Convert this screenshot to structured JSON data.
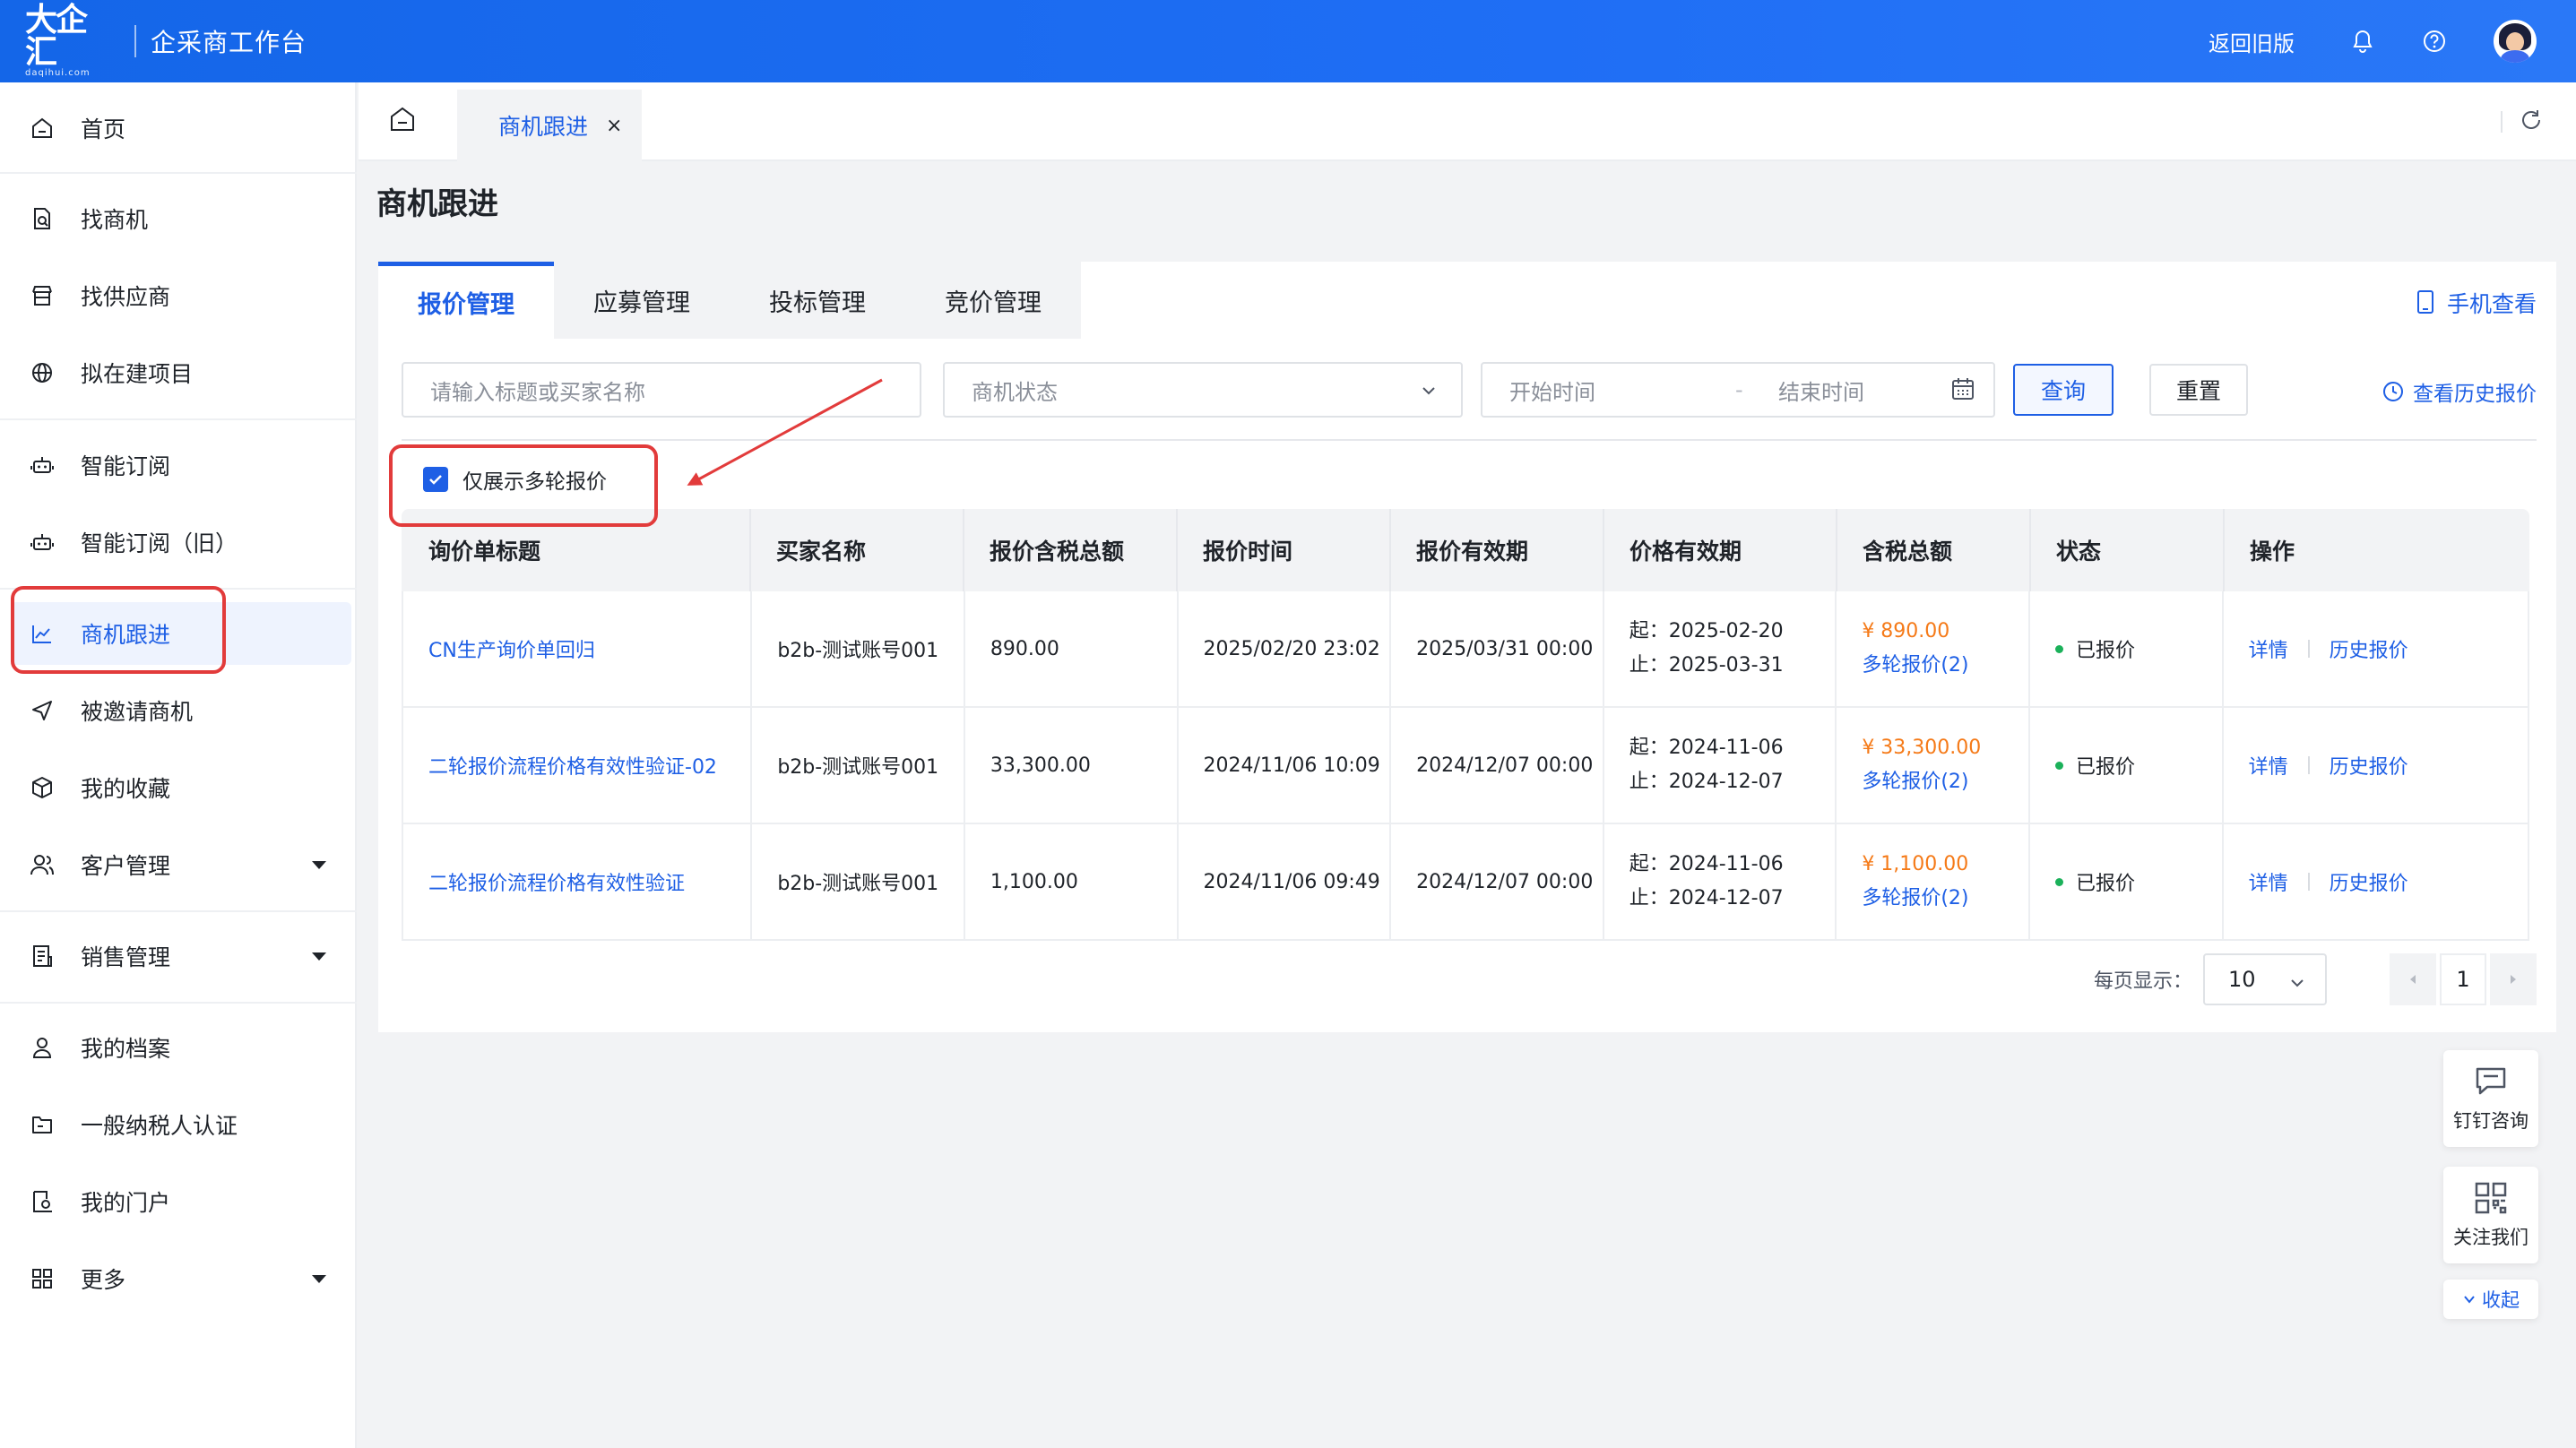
{
  "header": {
    "logo_main": "大企汇",
    "logo_sub": "daqihui.com",
    "app_title": "企采商工作台",
    "old_version": "返回旧版"
  },
  "sidebar": {
    "items": [
      {
        "label": "首页",
        "icon": "home-icon"
      },
      {
        "label": "找商机",
        "icon": "file-search-icon"
      },
      {
        "label": "找供应商",
        "icon": "store-icon"
      },
      {
        "label": "拟在建项目",
        "icon": "globe-icon"
      },
      {
        "label": "智能订阅",
        "icon": "robot-icon"
      },
      {
        "label": "智能订阅（旧）",
        "icon": "robot-icon"
      },
      {
        "label": "商机跟进",
        "icon": "chart-icon"
      },
      {
        "label": "被邀请商机",
        "icon": "send-icon"
      },
      {
        "label": "我的收藏",
        "icon": "cube-icon"
      },
      {
        "label": "客户管理",
        "icon": "users-icon"
      },
      {
        "label": "销售管理",
        "icon": "document-icon"
      },
      {
        "label": "我的档案",
        "icon": "user-icon"
      },
      {
        "label": "一般纳税人认证",
        "icon": "folder-icon"
      },
      {
        "label": "我的门户",
        "icon": "portal-icon"
      },
      {
        "label": "更多",
        "icon": "grid-icon"
      }
    ]
  },
  "tabs": {
    "active_label": "商机跟进",
    "close": "×"
  },
  "page": {
    "title": "商机跟进",
    "subtabs": [
      "报价管理",
      "应募管理",
      "投标管理",
      "竞价管理"
    ],
    "mobile_view": "手机查看",
    "history_quote": "查看历史报价"
  },
  "filters": {
    "keyword_placeholder": "请输入标题或买家名称",
    "status_placeholder": "商机状态",
    "start_placeholder": "开始时间",
    "range_sep": "-",
    "end_placeholder": "结束时间",
    "query_label": "查询",
    "reset_label": "重置",
    "multi_round_label": "仅展示多轮报价"
  },
  "table": {
    "headers": [
      "询价单标题",
      "买家名称",
      "报价含税总额",
      "报价时间",
      "报价有效期",
      "价格有效期",
      "含税总额",
      "状态",
      "操作"
    ],
    "rows": [
      {
        "title": "CN生产询价单回归",
        "buyer": "b2b-测试账号001",
        "total": "890.00",
        "quote_time": "2025/02/20 23:02",
        "quote_valid": "2025/03/31 00:00",
        "price_from": "起：2025-02-20",
        "price_to": "止：2025-03-31",
        "tax_total": "¥ 890.00",
        "multi": "多轮报价(2)",
        "status": "已报价",
        "op_detail": "详情",
        "op_history": "历史报价"
      },
      {
        "title": "二轮报价流程价格有效性验证-02",
        "buyer": "b2b-测试账号001",
        "total": "33,300.00",
        "quote_time": "2024/11/06 10:09",
        "quote_valid": "2024/12/07 00:00",
        "price_from": "起：2024-11-06",
        "price_to": "止：2024-12-07",
        "tax_total": "¥ 33,300.00",
        "multi": "多轮报价(2)",
        "status": "已报价",
        "op_detail": "详情",
        "op_history": "历史报价"
      },
      {
        "title": "二轮报价流程价格有效性验证",
        "buyer": "b2b-测试账号001",
        "total": "1,100.00",
        "quote_time": "2024/11/06 09:49",
        "quote_valid": "2024/12/07 00:00",
        "price_from": "起：2024-11-06",
        "price_to": "止：2024-12-07",
        "tax_total": "¥ 1,100.00",
        "multi": "多轮报价(2)",
        "status": "已报价",
        "op_detail": "详情",
        "op_history": "历史报价"
      }
    ]
  },
  "pager": {
    "per_page_label": "每页显示：",
    "per_page_value": "10",
    "current_page": "1"
  },
  "floating": {
    "dingtalk": "钉钉咨询",
    "follow": "关注我们",
    "collapse": "收起"
  },
  "colors": {
    "primary": "#1e5fe5",
    "accent_orange": "#f57a18",
    "status_green": "#1bb15a",
    "annotation_red": "#e23b3b"
  }
}
